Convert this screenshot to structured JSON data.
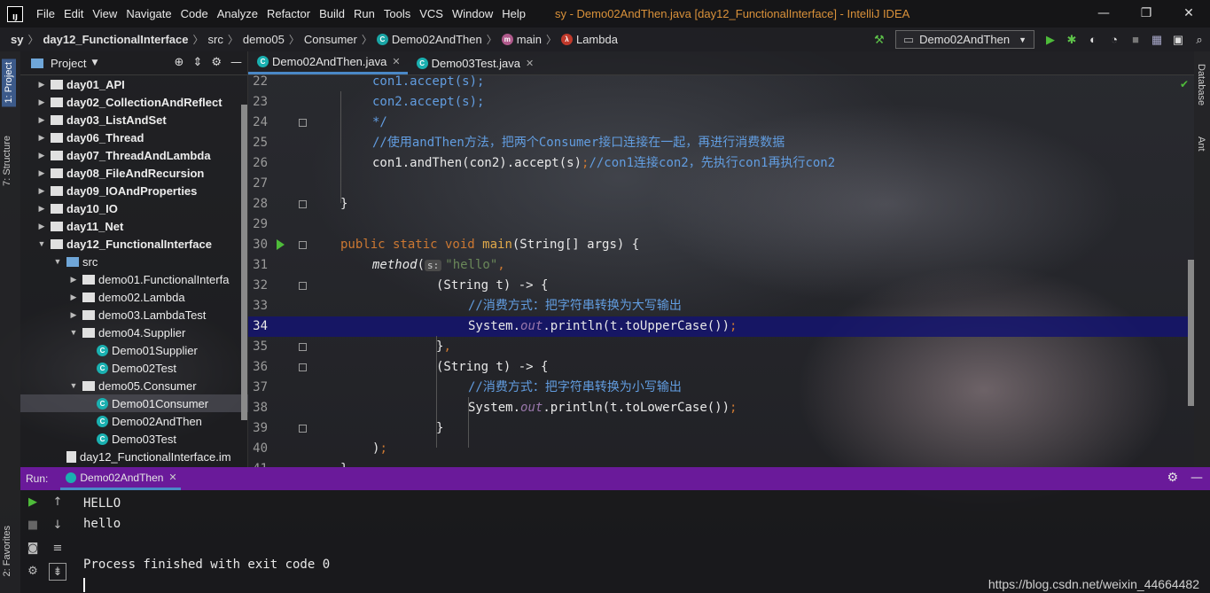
{
  "titlebar": {
    "menus": [
      "File",
      "Edit",
      "View",
      "Navigate",
      "Code",
      "Analyze",
      "Refactor",
      "Build",
      "Run",
      "Tools",
      "VCS",
      "Window",
      "Help"
    ],
    "title": "sy - Demo02AndThen.java [day12_FunctionalInterface] - IntelliJ IDEA"
  },
  "breadcrumb": {
    "items": [
      "sy",
      "day12_FunctionalInterface",
      "src",
      "demo05",
      "Consumer",
      "Demo02AndThen",
      "main",
      "Lambda"
    ]
  },
  "run_config": {
    "label": "Demo02AndThen"
  },
  "left_strip": {
    "project": "1: Project",
    "structure": "7: Structure",
    "favorites": "2: Favorites"
  },
  "right_strip": {
    "database": "Database",
    "ant": "Ant"
  },
  "project": {
    "title": "Project",
    "tree": [
      {
        "label": "day01_API",
        "indent": 0,
        "type": "module",
        "arrow": "▶"
      },
      {
        "label": "day02_CollectionAndReflect",
        "indent": 0,
        "type": "module",
        "arrow": "▶"
      },
      {
        "label": "day03_ListAndSet",
        "indent": 0,
        "type": "module",
        "arrow": "▶"
      },
      {
        "label": "day06_Thread",
        "indent": 0,
        "type": "module",
        "arrow": "▶"
      },
      {
        "label": "day07_ThreadAndLambda",
        "indent": 0,
        "type": "module",
        "arrow": "▶"
      },
      {
        "label": "day08_FileAndRecursion",
        "indent": 0,
        "type": "module",
        "arrow": "▶"
      },
      {
        "label": "day09_IOAndProperties",
        "indent": 0,
        "type": "module",
        "arrow": "▶"
      },
      {
        "label": "day10_IO",
        "indent": 0,
        "type": "module",
        "arrow": "▶"
      },
      {
        "label": "day11_Net",
        "indent": 0,
        "type": "module",
        "arrow": "▶"
      },
      {
        "label": "day12_FunctionalInterface",
        "indent": 0,
        "type": "module",
        "arrow": "▼"
      },
      {
        "label": "src",
        "indent": 1,
        "type": "src",
        "arrow": "▼"
      },
      {
        "label": "demo01.FunctionalInterfa",
        "indent": 2,
        "type": "package",
        "arrow": "▶"
      },
      {
        "label": "demo02.Lambda",
        "indent": 2,
        "type": "package",
        "arrow": "▶"
      },
      {
        "label": "demo03.LambdaTest",
        "indent": 2,
        "type": "package",
        "arrow": "▶"
      },
      {
        "label": "demo04.Supplier",
        "indent": 2,
        "type": "package",
        "arrow": "▼"
      },
      {
        "label": "Demo01Supplier",
        "indent": 3,
        "type": "class",
        "arrow": ""
      },
      {
        "label": "Demo02Test",
        "indent": 3,
        "type": "class",
        "arrow": ""
      },
      {
        "label": "demo05.Consumer",
        "indent": 2,
        "type": "package",
        "arrow": "▼"
      },
      {
        "label": "Demo01Consumer",
        "indent": 3,
        "type": "class",
        "arrow": "",
        "selected": true
      },
      {
        "label": "Demo02AndThen",
        "indent": 3,
        "type": "class",
        "arrow": ""
      },
      {
        "label": "Demo03Test",
        "indent": 3,
        "type": "class",
        "arrow": ""
      },
      {
        "label": "day12_FunctionalInterface.im",
        "indent": 1,
        "type": "file",
        "arrow": ""
      }
    ]
  },
  "editor": {
    "tabs": [
      {
        "label": "Demo02AndThen.java",
        "active": true
      },
      {
        "label": "Demo03Test.java",
        "active": false
      }
    ],
    "current_line": 34,
    "lines": [
      {
        "n": "22",
        "html": "<span class=\"c\">con1.accept(s);</span>"
      },
      {
        "n": "23",
        "html": "<span class=\"c\">con2.accept(s);</span>"
      },
      {
        "n": "24",
        "html": "<span class=\"c\">*/</span>"
      },
      {
        "n": "25",
        "html": "<span class=\"c\">//使用andThen方法，把两个Consumer接口连接在一起，再进行消费数据</span>"
      },
      {
        "n": "26",
        "html": "con1.andThen(con2).accept(s)<span class=\"k\">;</span><span class=\"c\">//con1连接con2，先执行con1再执行con2</span>"
      },
      {
        "n": "27",
        "html": ""
      },
      {
        "n": "28",
        "html": "}"
      },
      {
        "n": "29",
        "html": ""
      },
      {
        "n": "30",
        "html": "<span class=\"k\">public static void </span><span class=\"m\">main</span>(String[] args) {"
      },
      {
        "n": "31",
        "html": "<span class=\"mi\">method</span>(<span class=\"hint\">s:</span><span class=\"s\">\"hello\"</span><span class=\"k\">,</span>"
      },
      {
        "n": "32",
        "html": "(String t) -> {"
      },
      {
        "n": "33",
        "html": "<span class=\"c\">//消费方式：把字符串转换为大写输出</span>"
      },
      {
        "n": "34",
        "html": "System.<span class=\"st\">out</span>.println(t.toUpperCase())<span class=\"k\">;</span>"
      },
      {
        "n": "35",
        "html": "}<span class=\"k\">,</span>"
      },
      {
        "n": "36",
        "html": "(String t) -> {"
      },
      {
        "n": "37",
        "html": "<span class=\"c\">//消费方式：把字符串转换为小写输出</span>"
      },
      {
        "n": "38",
        "html": "System.<span class=\"st\">out</span>.println(t.toLowerCase())<span class=\"k\">;</span>"
      },
      {
        "n": "39",
        "html": "}"
      },
      {
        "n": "40",
        "html": ")<span class=\"k\">;</span>"
      },
      {
        "n": "41",
        "html": "}"
      }
    ]
  },
  "run": {
    "label": "Run:",
    "tab": "Demo02AndThen",
    "output": [
      "HELLO",
      "hello",
      "",
      "Process finished with exit code 0"
    ]
  },
  "watermark": "https://blog.csdn.net/weixin_44664482",
  "colors": {
    "keyword": "#cc7832",
    "method": "#e0a94a",
    "string": "#6a8759",
    "comment": "#629de0",
    "static_field": "#9876aa",
    "run_header": "#6a1a9a",
    "current_line": "#14146e"
  }
}
